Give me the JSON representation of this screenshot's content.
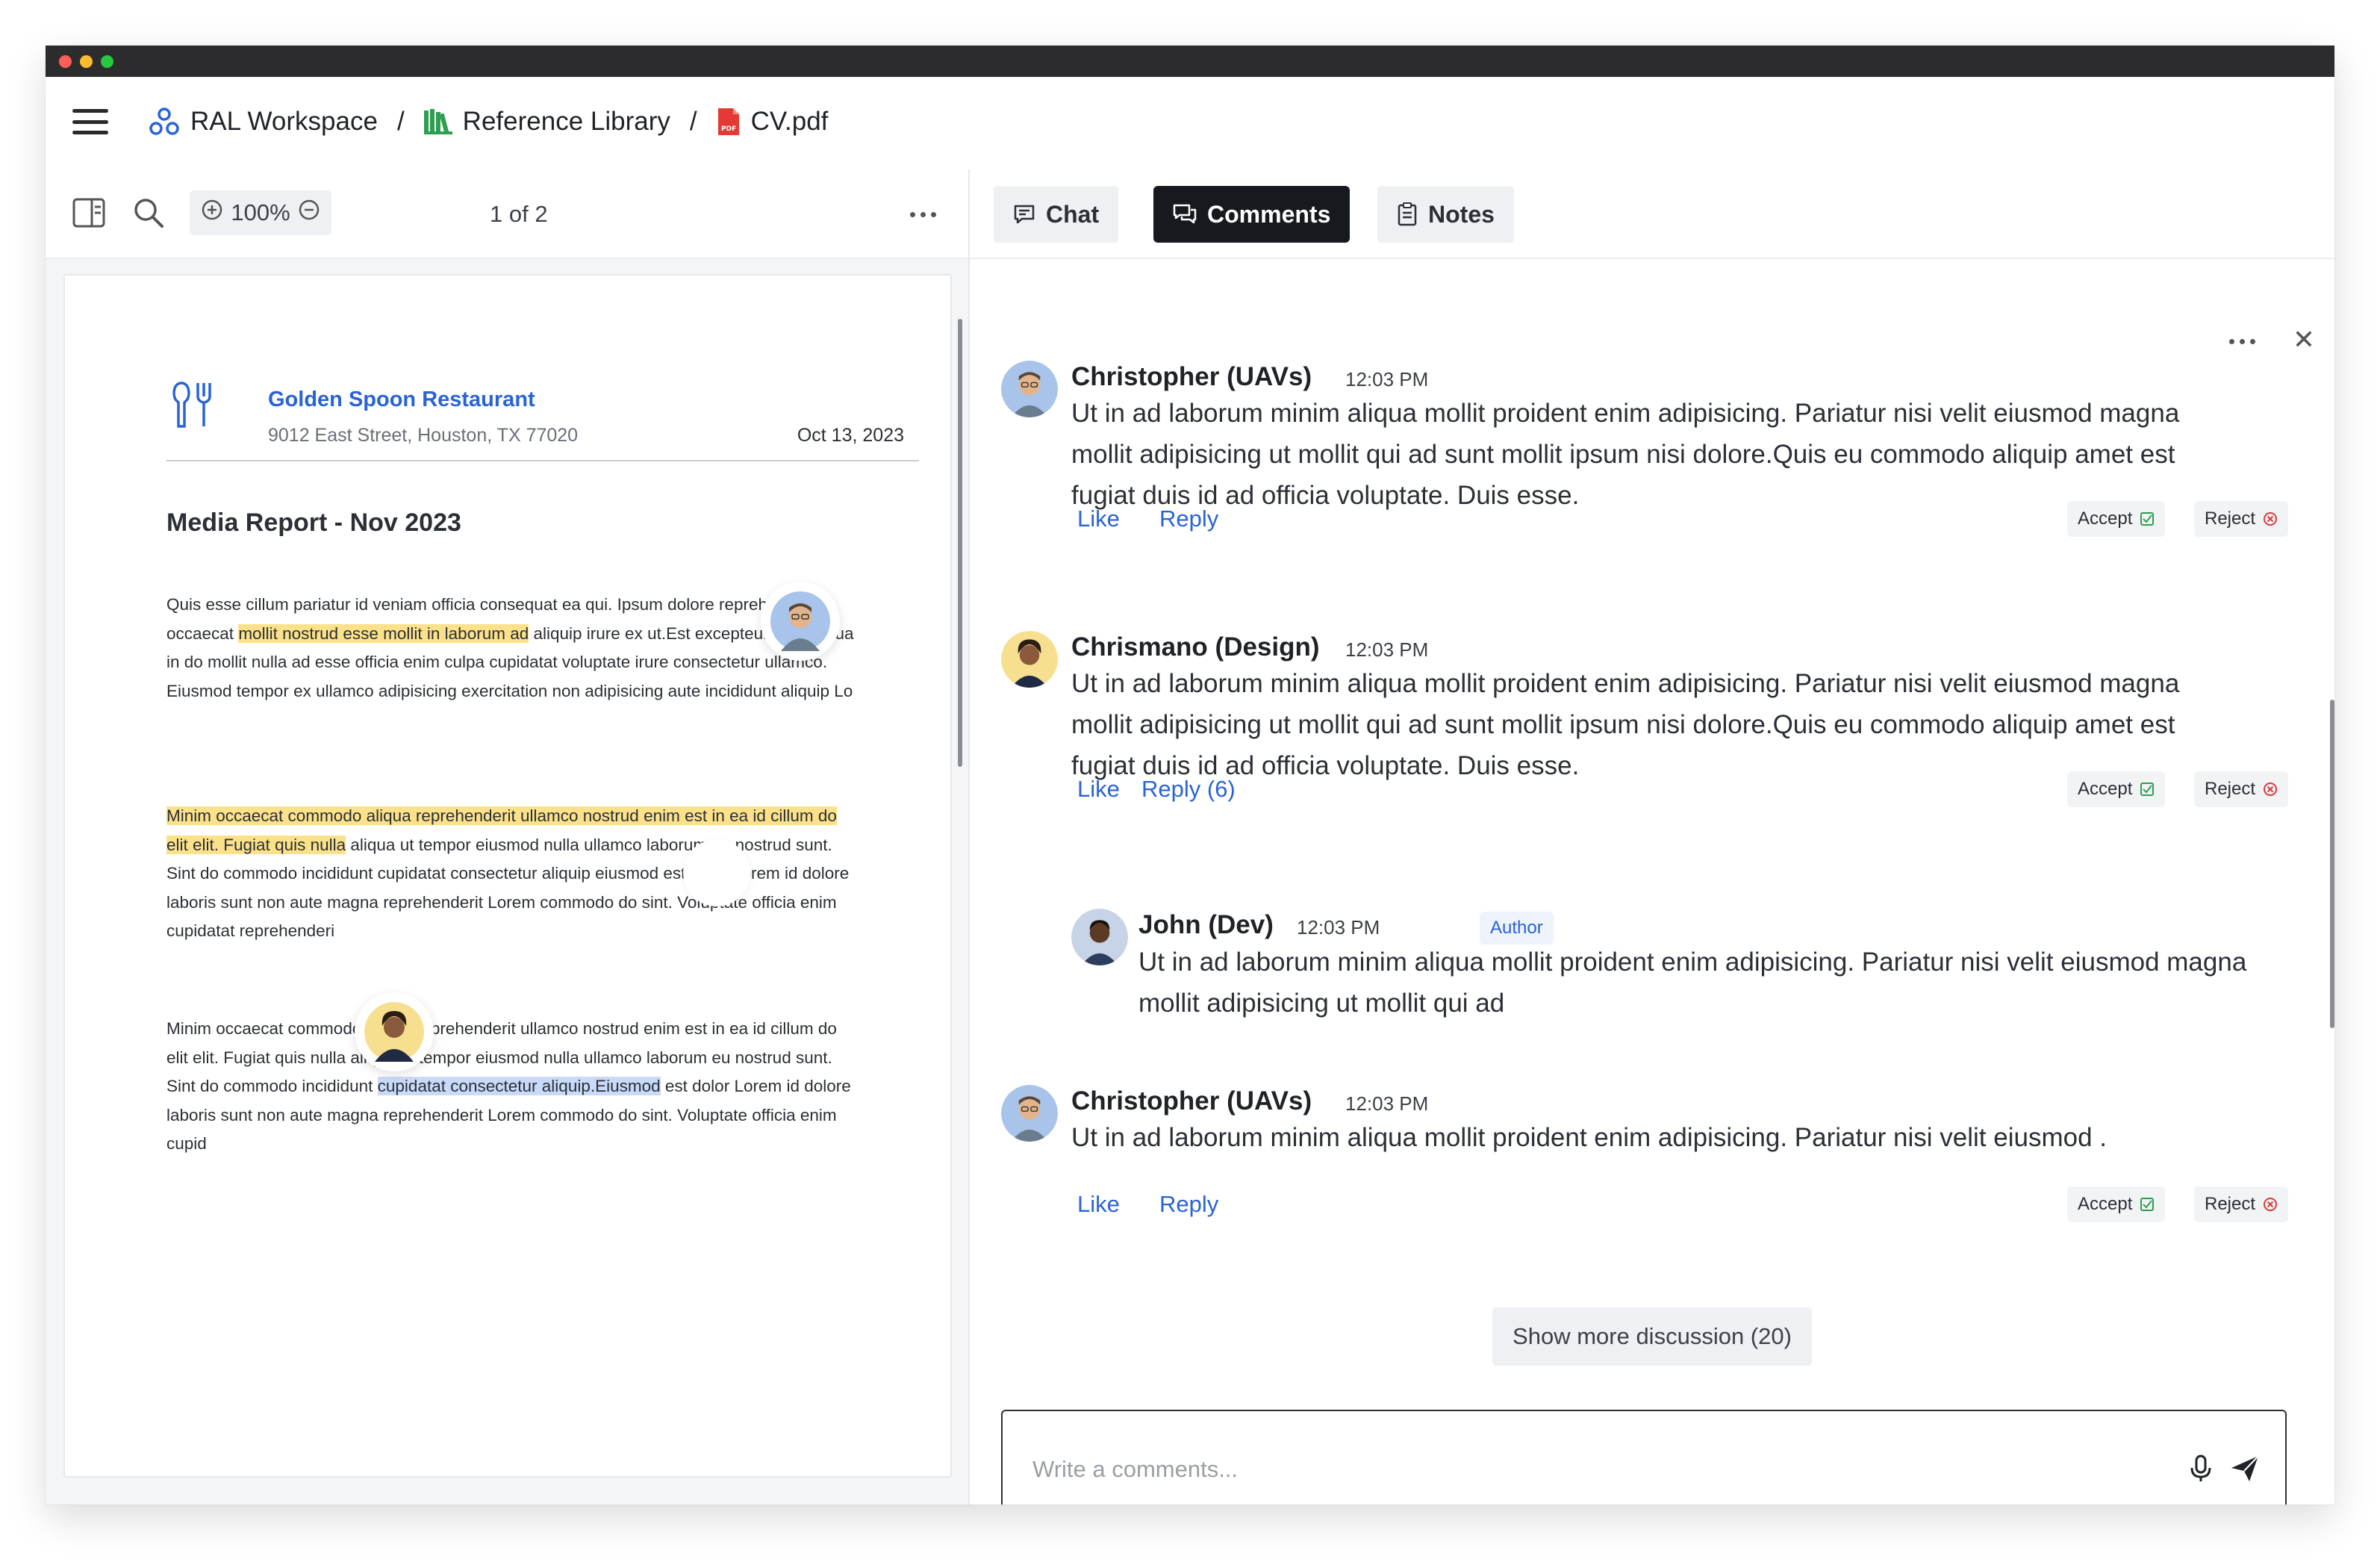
{
  "breadcrumb": {
    "workspace": "RAL Workspace",
    "separator": "/",
    "library": "Reference Library",
    "file": "CV.pdf"
  },
  "viewer": {
    "zoom": "100%",
    "pages": "1 of 2"
  },
  "document": {
    "company": "Golden Spoon Restaurant",
    "address": "9012 East Street, Houston, TX 77020",
    "date": "Oct 13, 2023",
    "title": "Media Report - Nov 2023",
    "p1": {
      "a": "Quis esse cillum pariatur id veniam officia consequat ea qui. Ipsum dolore reprehenderit occaecat ",
      "highlight": "mollit nostrud esse mollit in laborum ad",
      "b": " aliquip irure ex ut.Est excepteur duis aliqua in do mollit nulla ad esse officia enim culpa cupidatat voluptate irure consectetur ullamco. Eiusmod tempor ex ullamco adipisicing exercitation non adipisicing aute incididunt aliquip Lo"
    },
    "p2": {
      "highlight": "Minim occaecat commodo aliqua reprehenderit ullamco nostrud enim est in ea id cillum do elit elit. Fugiat quis nulla",
      "b": " aliqua ut tempor eiusmod nulla ullamco laborum eu nostrud sunt. Sint do commodo incididunt cupidatat consectetur aliquip eiusmod est dolor Lorem id dolore laboris sunt non aute magna reprehenderit Lorem commodo do sint. Voluptate officia enim cupidatat reprehenderi"
    },
    "p3": {
      "a": "Minim occaecat commodo aliqua reprehenderit ullamco nostrud enim est in ea id cillum do elit elit. Fugiat quis nulla aliqua ut tempor eiusmod nulla ullamco laborum eu nostrud sunt. Sint do commodo incididunt ",
      "highlight": "cupidatat consectetur aliquip.Eiusmod",
      "b": " est dolor Lorem id dolore laboris sunt non aute magna reprehenderit Lorem commodo do sint. Voluptate officia enim cupid"
    }
  },
  "tabs": [
    {
      "label": "Chat",
      "active": false
    },
    {
      "label": "Comments",
      "active": true
    },
    {
      "label": "Notes",
      "active": false
    }
  ],
  "comments": [
    {
      "name": "Christopher (UAVs)",
      "time": "12:03 PM",
      "text": "Ut in ad laborum minim aliqua mollit proident enim adipisicing. Pariatur nisi velit eiusmod magna mollit adipisicing ut mollit qui ad sunt mollit ipsum nisi dolore.Quis eu commodo aliquip amet est fugiat duis id ad officia voluptate. Duis esse.",
      "like": "Like",
      "reply": "Reply"
    },
    {
      "name": "Chrismano (Design)",
      "time": "12:03 PM",
      "text": "Ut in ad laborum minim aliqua mollit proident enim adipisicing. Pariatur nisi velit eiusmod magna mollit adipisicing ut mollit qui ad sunt mollit ipsum nisi dolore.Quis eu commodo aliquip amet est fugiat duis id ad officia voluptate. Duis esse.",
      "like": "Like",
      "reply": "Reply (6)"
    },
    {
      "name": "John (Dev)",
      "time": "12:03 PM",
      "badge": "Author",
      "text": "Ut in ad laborum minim aliqua mollit proident enim adipisicing. Pariatur nisi velit eiusmod magna mollit adipisicing ut mollit qui ad"
    },
    {
      "name": "Christopher (UAVs)",
      "time": "12:03 PM",
      "text": "Ut in ad laborum minim aliqua mollit proident enim adipisicing. Pariatur nisi velit eiusmod .",
      "like": "Like",
      "reply": "Reply"
    }
  ],
  "actions": {
    "accept": "Accept",
    "reject": "Reject"
  },
  "show_more": "Show more discussion (20)",
  "composer": {
    "placeholder": "Write a comments..."
  },
  "colors": {
    "accent": "#2a63d4",
    "highlight_yellow": "#fbe28a",
    "highlight_blue": "#c9daf8",
    "active_tab": "#16191d",
    "accept": "#2e9e4f",
    "reject": "#d93b3b"
  }
}
